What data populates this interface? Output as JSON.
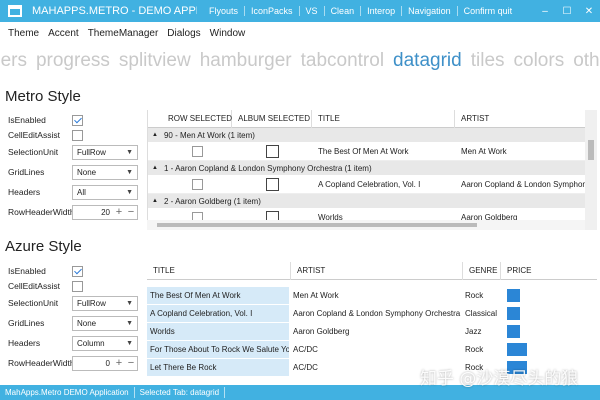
{
  "window": {
    "title": "MAHAPPS.METRO - DEMO APPLIC...",
    "commands": [
      "Flyouts",
      "IconPacks",
      "VS",
      "Clean",
      "Interop",
      "Navigation",
      "Confirm quit"
    ],
    "controls": {
      "minimize": "–",
      "maximize": "☐",
      "close": "✕"
    },
    "accent": "#41b1e1"
  },
  "menu": [
    "Theme",
    "Accent",
    "ThemeManager",
    "Dialogs",
    "Window"
  ],
  "pivot": {
    "items": [
      "ders",
      "progress",
      "splitview",
      "hamburger",
      "tabcontrol",
      "datagrid",
      "tiles",
      "colors",
      "others"
    ],
    "selected": "datagrid"
  },
  "metro": {
    "title": "Metro Style",
    "settings": {
      "is_enabled_label": "IsEnabled",
      "cell_edit_label": "CellEditAssist",
      "selection_unit_label": "SelectionUnit",
      "selection_unit_value": "FullRow",
      "gridlines_label": "GridLines",
      "gridlines_value": "None",
      "headers_label": "Headers",
      "headers_value": "All",
      "row_header_width_label": "RowHeaderWidth",
      "row_header_width_value": "20"
    },
    "grid": {
      "columns": [
        "ROW SELECTED",
        "ALBUM SELECTED",
        "TITLE",
        "ARTIST"
      ],
      "groups": [
        {
          "header": "90 - Men At Work (1 item)",
          "title": "The Best Of Men At Work",
          "artist": "Men At Work"
        },
        {
          "header": "1 - Aaron Copland & London Symphony Orchestra (1 item)",
          "title": "A Copland Celebration, Vol. I",
          "artist": "Aaron Copland & London Symphony"
        },
        {
          "header": "2 - Aaron Goldberg (1 item)",
          "title": "Worlds",
          "artist": "Aaron Goldberg"
        }
      ]
    }
  },
  "azure": {
    "title": "Azure Style",
    "settings": {
      "is_enabled_label": "IsEnabled",
      "cell_edit_label": "CellEditAssist",
      "selection_unit_label": "SelectionUnit",
      "selection_unit_value": "FullRow",
      "gridlines_label": "GridLines",
      "gridlines_value": "None",
      "headers_label": "Headers",
      "headers_value": "Column",
      "row_header_width_label": "RowHeaderWidth",
      "row_header_width_value": "0"
    },
    "grid": {
      "columns": [
        "TITLE",
        "ARTIST",
        "GENRE",
        "PRICE"
      ],
      "rows": [
        {
          "title": "The Best Of Men At Work",
          "artist": "Men At Work",
          "genre": "Rock",
          "price_level": 0.38
        },
        {
          "title": "A Copland Celebration, Vol. I",
          "artist": "Aaron Copland & London Symphony Orchestra",
          "genre": "Classical",
          "price_level": 0.38
        },
        {
          "title": "Worlds",
          "artist": "Aaron Goldberg",
          "genre": "Jazz",
          "price_level": 0.38
        },
        {
          "title": "For Those About To Rock We Salute You",
          "artist": "AC/DC",
          "genre": "Rock",
          "price_level": 0.6
        },
        {
          "title": "Let There Be Rock",
          "artist": "AC/DC",
          "genre": "Rock",
          "price_level": 0.6
        }
      ]
    }
  },
  "status": {
    "app_name": "MahApps.Metro DEMO Application",
    "selected_tab": "Selected Tab:  datagrid"
  },
  "watermark": "知乎 @沙漠尽头的狼"
}
